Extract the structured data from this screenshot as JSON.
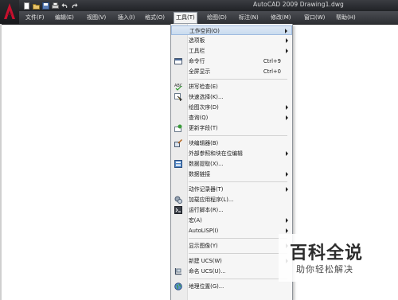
{
  "window": {
    "title": "AutoCAD 2009  Drawing1.dwg"
  },
  "quick_access": {
    "icons": [
      "new-icon",
      "open-icon",
      "save-icon",
      "print-icon",
      "undo-icon",
      "redo-icon"
    ]
  },
  "menubar": {
    "items": [
      {
        "label": "文件(F)"
      },
      {
        "label": "编辑(E)"
      },
      {
        "label": "视图(V)"
      },
      {
        "label": "插入(I)"
      },
      {
        "label": "格式(O)"
      },
      {
        "label": "工具(T)",
        "active": true
      },
      {
        "label": "绘图(D)"
      },
      {
        "label": "标注(N)"
      },
      {
        "label": "修改(M)"
      },
      {
        "label": "窗口(W)"
      },
      {
        "label": "帮助(H)"
      }
    ]
  },
  "tools_menu": {
    "items": [
      {
        "label": "工作空间(O)",
        "submenu": true,
        "highlighted": true
      },
      {
        "label": "选项板",
        "submenu": true
      },
      {
        "label": "工具栏",
        "submenu": true
      },
      {
        "label": "命令行",
        "shortcut": "Ctrl+9",
        "icon": "command-line-icon"
      },
      {
        "label": "全屏显示",
        "shortcut": "Ctrl+0"
      },
      {
        "label": "拼写检查(E)",
        "icon": "spell-check-icon"
      },
      {
        "label": "快速选择(K)...",
        "icon": "quick-select-icon"
      },
      {
        "label": "绘图次序(D)",
        "submenu": true
      },
      {
        "label": "查询(Q)",
        "submenu": true
      },
      {
        "label": "更新字段(T)",
        "icon": "update-field-icon"
      },
      {
        "label": "块编辑器(B)",
        "icon": "block-editor-icon"
      },
      {
        "label": "外部参照和块在位编辑",
        "submenu": true
      },
      {
        "label": "数据提取(X)...",
        "icon": "data-extraction-icon"
      },
      {
        "label": "数据链接",
        "submenu": true
      },
      {
        "label": "动作记录器(T)",
        "submenu": true
      },
      {
        "label": "加载应用程序(L)...",
        "icon": "load-application-icon"
      },
      {
        "label": "运行脚本(R)...",
        "icon": "run-script-icon"
      },
      {
        "label": "宏(A)",
        "submenu": true
      },
      {
        "label": "AutoLISP(I)",
        "submenu": true
      },
      {
        "label": "显示图像(Y)",
        "submenu": true
      },
      {
        "label": "新建 UCS(W)",
        "submenu": true
      },
      {
        "label": "命名 UCS(U)...",
        "icon": "named-ucs-icon"
      },
      {
        "label": "地理位置(G)...",
        "icon": "geographic-location-icon"
      }
    ]
  },
  "watermark": {
    "title": "百科全说",
    "subtitle": "助你轻松解决"
  },
  "colors": {
    "titlebar": "#2b2d31",
    "menubar": "#3c3e43",
    "menu_bg": "#f6f6f6",
    "highlight": "#c9dbef",
    "logo_red": "#c8102e"
  }
}
